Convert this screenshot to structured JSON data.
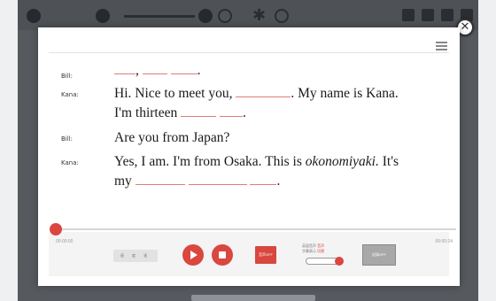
{
  "dialogue": {
    "lines": [
      {
        "speaker": "Bill:",
        "parts": [
          "",
          ", ",
          ""
        ],
        "tail": "."
      },
      {
        "speaker": "Kana:",
        "text1": "Hi. Nice to meet you, ",
        "text2": ". My name is Kana.",
        "text3": "I'm thirteen ",
        "text4": "."
      },
      {
        "speaker": "Bill:",
        "text": "Are you from Japan?"
      },
      {
        "speaker": "Kana:",
        "text1": "Yes, I am. I'm from Osaka. This is ",
        "italic": "okonomiyaki.",
        "text2": " It's",
        "text3": "my ",
        "text4": "."
      }
    ]
  },
  "player": {
    "time_start": "00:00:00",
    "time_end": "00:00:24",
    "speed_label": "速 度 速",
    "play_label": "play",
    "stop_label": "stop",
    "record_label": "音声OFF",
    "toggle_label_a": "英語音声",
    "toggle_label_a2": "字幕表示",
    "toggle_label_b": "音声",
    "toggle_label_b2": "切替",
    "mode_label": "記録OFF"
  },
  "colors": {
    "accent": "#d9473f",
    "blank_underline": "#e07b78"
  }
}
